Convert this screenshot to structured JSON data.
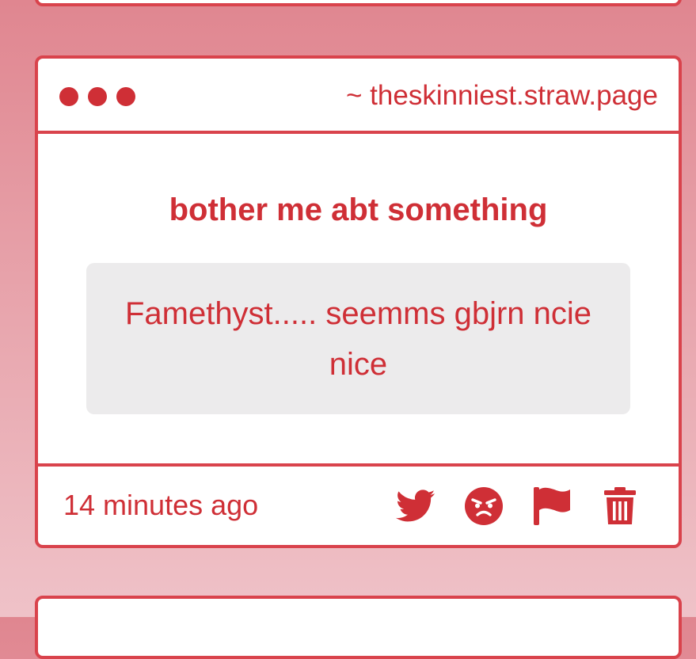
{
  "colors": {
    "accent": "#cf2f36",
    "border": "#d9434c",
    "answer_bg": "#ecebec",
    "page_bg_top": "#e08690",
    "page_bg_bottom": "#efc2c8"
  },
  "window": {
    "controls": [
      "dot",
      "dot",
      "dot"
    ],
    "site_url": "~ theskinniest.straw.page"
  },
  "question": {
    "prompt": "bother me abt something",
    "answer": "Famethyst..... seemms gbjrn ncie nice"
  },
  "footer": {
    "timestamp": "14 minutes ago",
    "actions": [
      {
        "name": "share-twitter",
        "icon": "twitter-icon"
      },
      {
        "name": "react-angry",
        "icon": "angry-face-icon"
      },
      {
        "name": "report",
        "icon": "flag-icon"
      },
      {
        "name": "delete",
        "icon": "trash-icon"
      }
    ]
  }
}
